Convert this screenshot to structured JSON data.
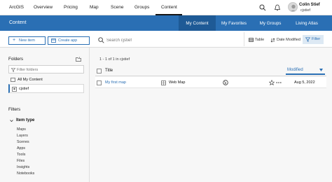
{
  "topnav": {
    "brand": "ArcGIS",
    "items": [
      "Overview",
      "Pricing",
      "Map",
      "Scene",
      "Groups",
      "Content"
    ],
    "active_item": "Content",
    "user_name": "Colin Stief",
    "user_id": "cjstief"
  },
  "contentbar": {
    "title": "Content",
    "tabs": [
      "My Content",
      "My Favorites",
      "My Groups",
      "Living Atlas"
    ],
    "active_tab": "My Content"
  },
  "toolbar": {
    "new_item": "New item",
    "create_app": "Create app",
    "search_placeholder": "Search cjstief",
    "table": "Table",
    "sort": "Date Modified",
    "filter": "Filter"
  },
  "sidebar": {
    "folders_heading": "Folders",
    "filter_folders_placeholder": "Filter folders",
    "folders": [
      "All My Content",
      "cjstief"
    ],
    "selected_folder": "cjstief",
    "filters_heading": "Filters",
    "item_type_heading": "Item type",
    "item_types": [
      "Maps",
      "Layers",
      "Scenes",
      "Apps",
      "Tools",
      "Files",
      "Insights",
      "Notebooks"
    ]
  },
  "main": {
    "count": "1 - 1 of 1 in cjstief",
    "columns": {
      "title": "Title",
      "modified": "Modified"
    },
    "rows": [
      {
        "title": "My first map",
        "type": "Web Map",
        "modified": "Aug 5, 2022"
      }
    ]
  },
  "colors": {
    "primary": "#2a6fb4",
    "active_tab": "#1e5a96"
  }
}
